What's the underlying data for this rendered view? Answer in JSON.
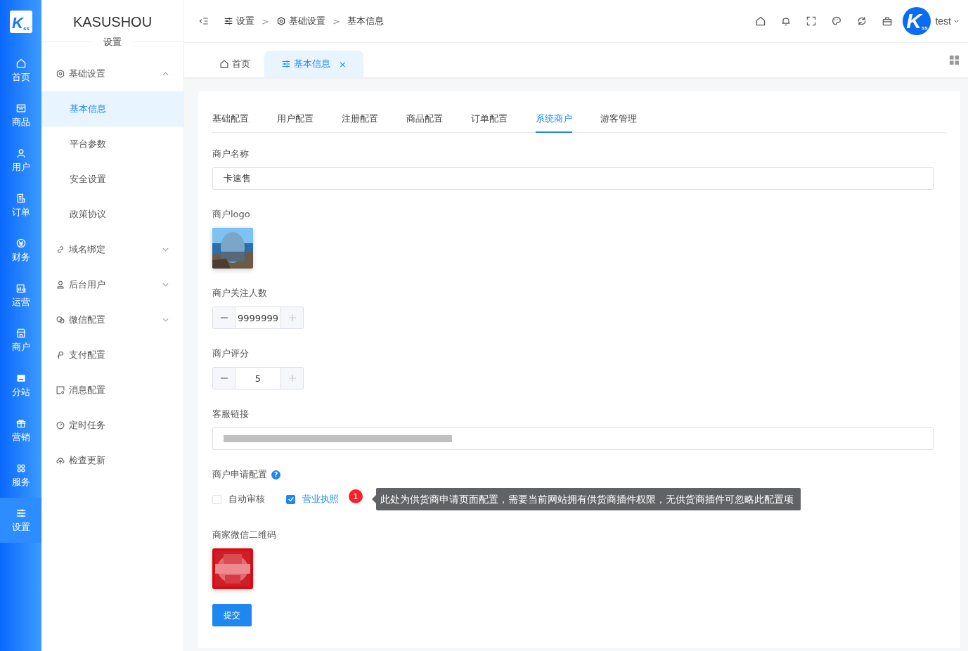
{
  "logo": {
    "letter": "K",
    "sub": "ss"
  },
  "nav": [
    {
      "label": "首页",
      "selected": false
    },
    {
      "label": "商品",
      "selected": false
    },
    {
      "label": "用户",
      "selected": false
    },
    {
      "label": "订单",
      "selected": false
    },
    {
      "label": "财务",
      "selected": false
    },
    {
      "label": "运营",
      "selected": false
    },
    {
      "label": "商户",
      "selected": false
    },
    {
      "label": "分站",
      "selected": false
    },
    {
      "label": "营销",
      "selected": false
    },
    {
      "label": "服务",
      "selected": false
    },
    {
      "label": "设置",
      "selected": true
    }
  ],
  "sidebar": {
    "title": "KASUSHOU",
    "subtitle": "设置",
    "items": [
      {
        "label": "基础设置",
        "expanded": true,
        "children": [
          {
            "label": "基本信息",
            "selected": true
          },
          {
            "label": "平台参数",
            "selected": false
          },
          {
            "label": "安全设置",
            "selected": false
          },
          {
            "label": "政策协议",
            "selected": false
          }
        ]
      },
      {
        "label": "域名绑定",
        "expanded": false
      },
      {
        "label": "后台用户",
        "expanded": false
      },
      {
        "label": "微信配置",
        "expanded": false
      },
      {
        "label": "支付配置"
      },
      {
        "label": "消息配置"
      },
      {
        "label": "定时任务"
      },
      {
        "label": "检查更新"
      }
    ]
  },
  "breadcrumb": {
    "separator": ">",
    "items": [
      "设置",
      "基础设置",
      "基本信息"
    ]
  },
  "user": {
    "name": "test",
    "avatar_letter": "K",
    "avatar_sub": "ss"
  },
  "page_tabs": [
    {
      "label": "首页",
      "selected": false
    },
    {
      "label": "基本信息",
      "selected": true,
      "close": "×"
    }
  ],
  "section_tabs": [
    {
      "label": "基础配置",
      "selected": false
    },
    {
      "label": "用户配置",
      "selected": false
    },
    {
      "label": "注册配置",
      "selected": false
    },
    {
      "label": "商品配置",
      "selected": false
    },
    {
      "label": "订单配置",
      "selected": false
    },
    {
      "label": "系统商户",
      "selected": true
    },
    {
      "label": "游客管理",
      "selected": false
    }
  ],
  "form": [
    {
      "kind": "text",
      "label": "商户名称",
      "value": "卡速售"
    },
    {
      "label": "商户logo"
    },
    {
      "kind": "number",
      "label": "商户关注人数",
      "value": "9999999",
      "increase_disabled": true
    },
    {
      "kind": "number",
      "label": "商户评分",
      "value": "5",
      "increase_disabled": true
    },
    {
      "kind": "redacted",
      "label": "客服链接"
    },
    {
      "kind": "checkboxes",
      "label": "商户申请配置",
      "help": "?",
      "options": [
        {
          "label": "自动审核",
          "checked": false
        },
        {
          "label": "营业执照",
          "checked": true
        }
      ],
      "badge": "1",
      "tooltip": "此处为供货商申请页面配置，需要当前网站拥有供货商插件权限，无供货商插件可忽略此配置项"
    },
    {
      "label": "商家微信二维码"
    }
  ],
  "submit": "提交"
}
